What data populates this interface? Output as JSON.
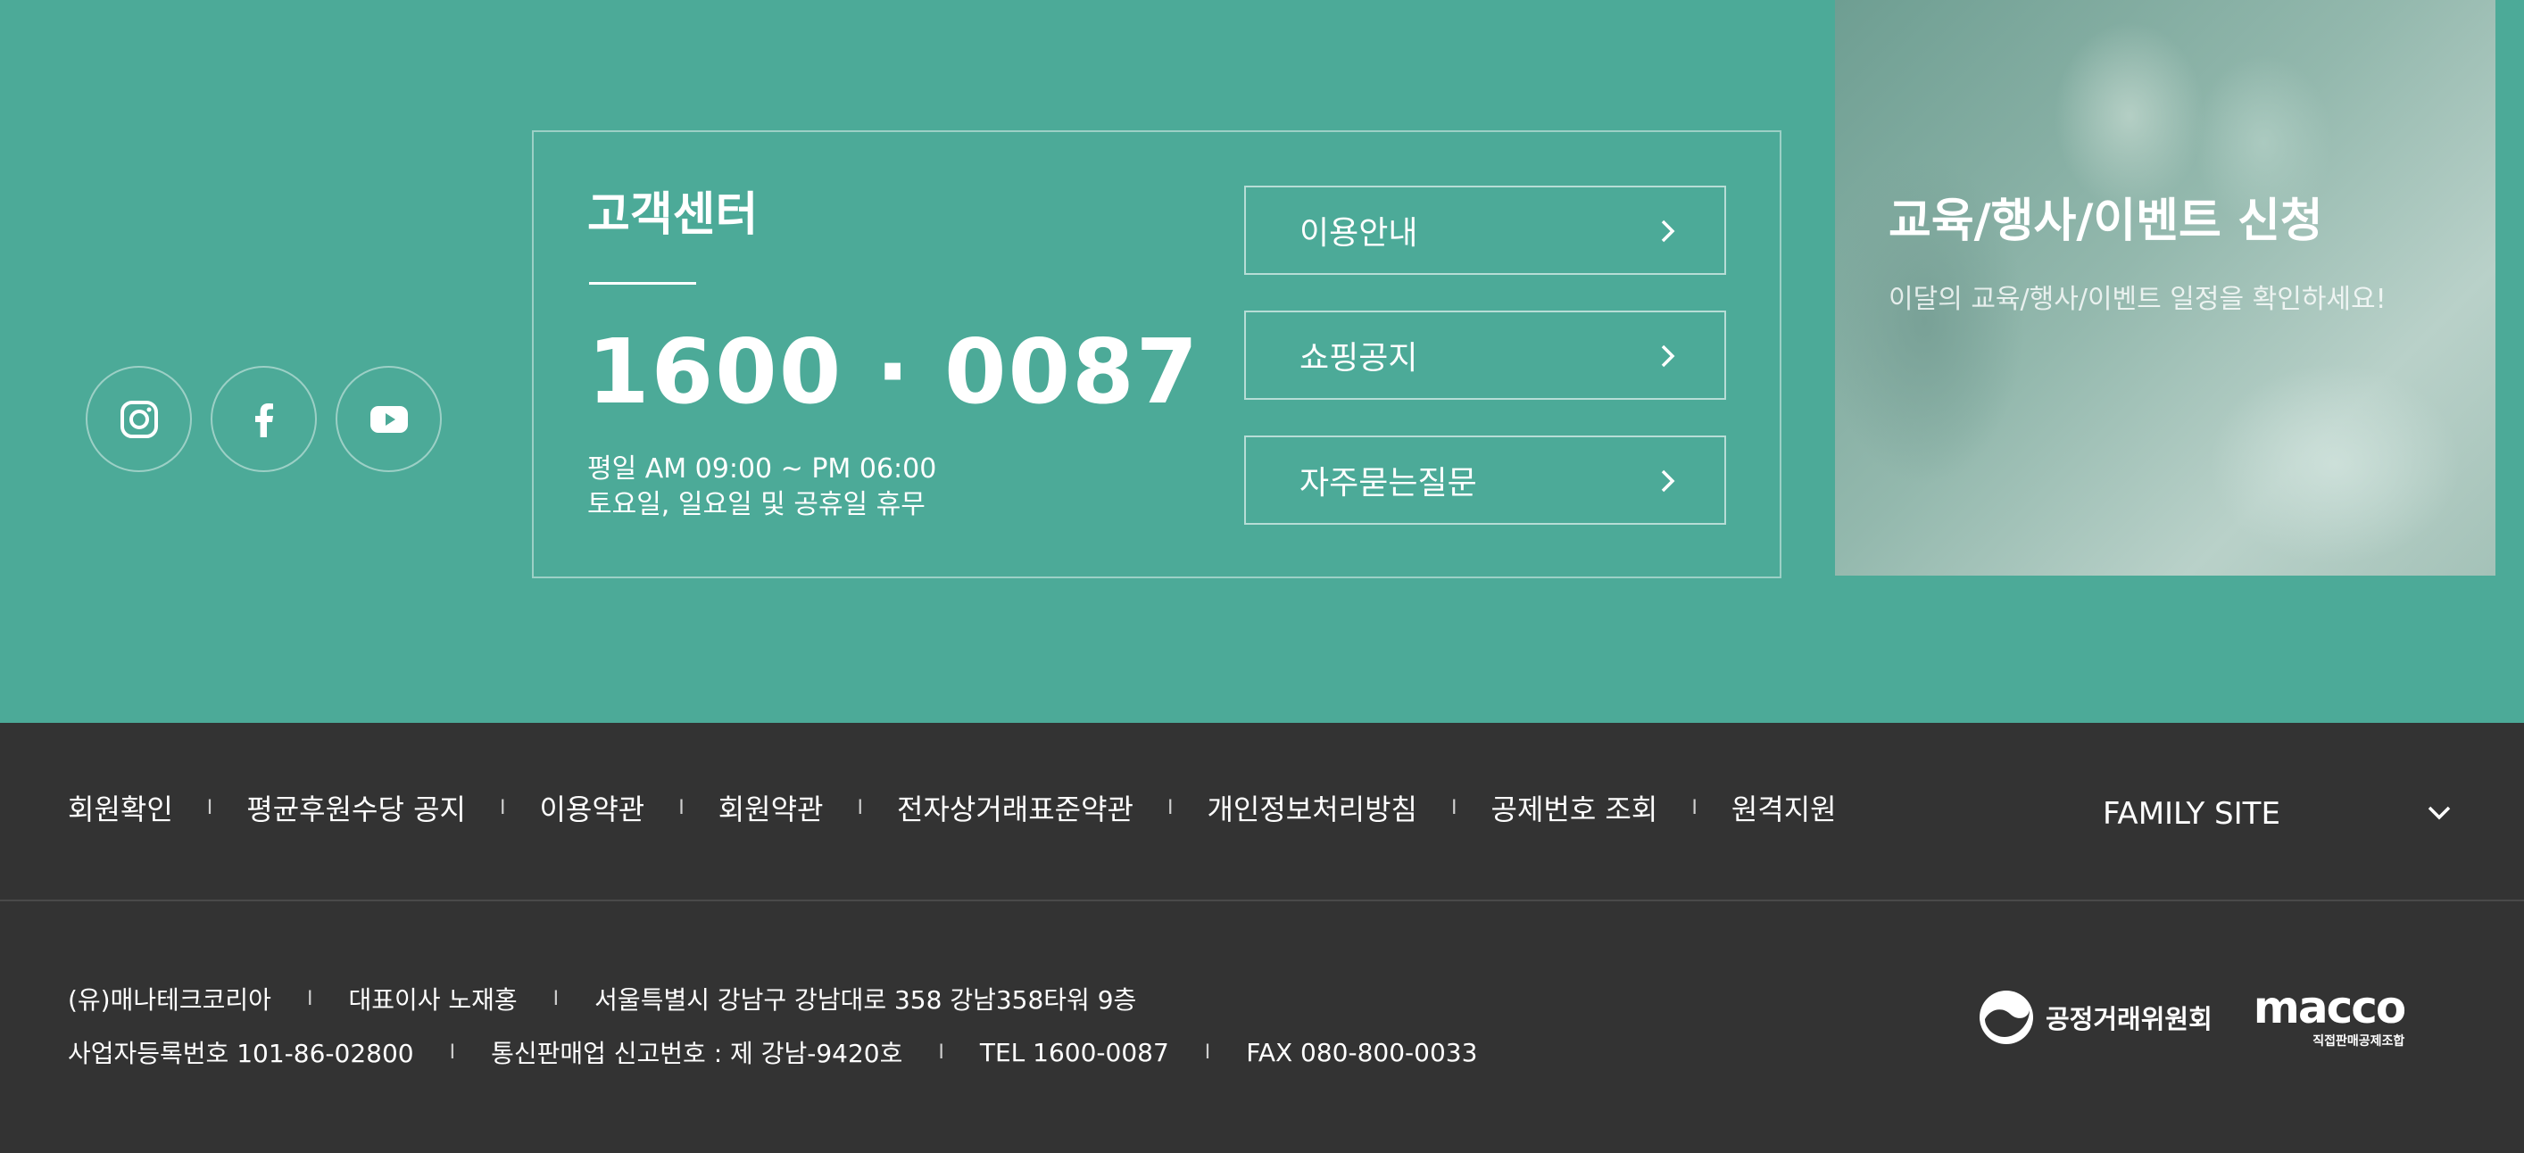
{
  "colors": {
    "teal_background": "#4caa98",
    "footer_background": "#333333",
    "text_white": "#ffffff"
  },
  "social": [
    {
      "icon": "instagram-icon"
    },
    {
      "icon": "facebook-icon"
    },
    {
      "icon": "youtube-icon"
    }
  ],
  "customer_center": {
    "title": "고객센터",
    "phone": "1600 · 0087",
    "hours_weekday": "평일 AM 09:00 ~ PM 06:00",
    "hours_closed": "토요일, 일요일 및 공휴일 휴무",
    "links": [
      {
        "label": "이용안내",
        "icon": "chevron-right-icon"
      },
      {
        "label": "쇼핑공지",
        "icon": "chevron-right-icon"
      },
      {
        "label": "자주묻는질문",
        "icon": "chevron-right-icon"
      }
    ]
  },
  "event": {
    "title": "교육/행사/이벤트 신청",
    "subtitle": "이달의 교육/행사/이벤트 일정을 확인하세요!"
  },
  "nav": {
    "items": [
      "회원확인",
      "평균후원수당 공지",
      "이용약관",
      "회원약관",
      "전자상거래표준약관",
      "개인정보처리방침",
      "공제번호 조회",
      "원격지원"
    ],
    "separator": "I",
    "family_site": "FAMILY SITE"
  },
  "company": {
    "row1": [
      "(유)매나테크코리아",
      "대표이사 노재홍",
      "서울특별시 강남구 강남대로 358 강남358타워 9층"
    ],
    "row2": [
      "사업자등록번호 101-86-02800",
      "통신판매업 신고번호 : 제 강남-9420호",
      "TEL 1600-0087",
      "FAX 080-800-0033"
    ]
  },
  "logos": {
    "ftc": "공정거래위원회",
    "macco": "macco",
    "macco_sub": "직접판매공제조합"
  }
}
